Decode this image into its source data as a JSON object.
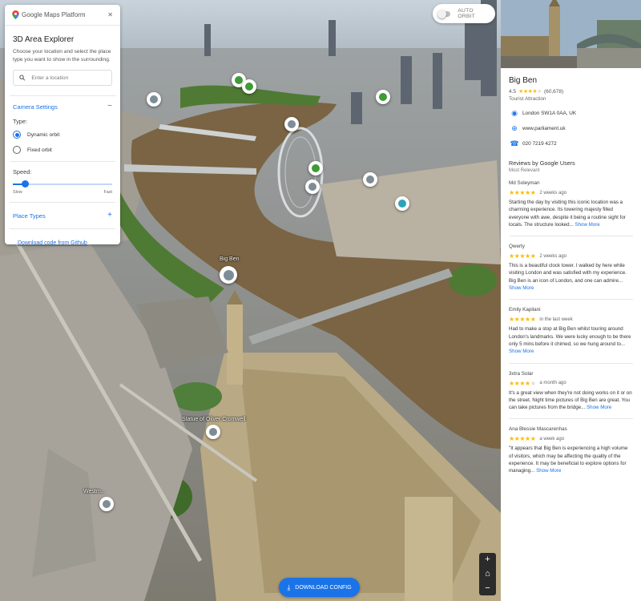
{
  "panel": {
    "brand": "Google Maps Platform",
    "title": "3D Area Explorer",
    "description": "Choose your location and select the place type you want to show in the surrounding.",
    "search_placeholder": "Enter a location",
    "camera_settings": "Camera Settings",
    "type_label": "Type:",
    "dynamic_orbit": "Dynamic orbit",
    "fixed_orbit": "Fixed orbit",
    "selected_type": "Dynamic orbit",
    "speed_label": "Speed:",
    "speed_min": "Slow",
    "speed_max": "Fast",
    "speed_value": 0.12,
    "place_types": "Place Types",
    "github_link": "Download code from Github"
  },
  "auto_orbit": {
    "label": "AUTO ORBIT",
    "enabled": false
  },
  "download_button": "DOWNLOAD CONFIG",
  "map_labels": {
    "big_ben": "Big Ben",
    "cromwell": "Statue of Oliver Cromwell",
    "westminster": "Westm..."
  },
  "place": {
    "name": "Big Ben",
    "rating": "4.5",
    "rating_count": "(60,678)",
    "type": "Tourist Attraction",
    "address": "London SW1A 0AA, UK",
    "website": "www.parliament.uk",
    "phone": "020 7219 4272"
  },
  "reviews_title": "Reviews by Google Users",
  "reviews_sort": "Most Relevant",
  "show_more": "Show More",
  "reviews": [
    {
      "author": "Md Soleyman",
      "stars": 5,
      "when": "2 weeks ago",
      "text": "Starting the day by visiting this iconic location was a charming experience. Its towering majesty filled everyone with awe, despite it being a routine sight for locals. The structure looked..."
    },
    {
      "author": "Qwerty",
      "stars": 5,
      "when": "2 weeks ago",
      "text": "This is a beautiful clock tower. I walked by here while visiting London and was satisfied with my experience. Big Ben is an icon of London, and one can admire..."
    },
    {
      "author": "Emily Kapilani",
      "stars": 5,
      "when": "in the last week",
      "text": "Had to make a stop at Big Ben whilst touring around London's landmarks. We were lucky enough to be there only 5 mins before it chimed, so we hung around to..."
    },
    {
      "author": "3xtra Solar",
      "stars": 4,
      "when": "a month ago",
      "text": "It's a great view when they're not doing works on it or on the street. Night time pictures of Big Ben are great. You can take pictures from the bridge..."
    },
    {
      "author": "Ana Blessie Mascarenhas",
      "stars": 5,
      "when": "a week ago",
      "text": "\"It appears that Big Ben is experiencing a high volume of visitors, which may be affecting the quality of the experience. It may be beneficial to explore options for managing..."
    }
  ],
  "colors": {
    "accent": "#1a73e8",
    "star": "#fbbc04",
    "river": "#7a6444",
    "park": "#4f7a34"
  }
}
